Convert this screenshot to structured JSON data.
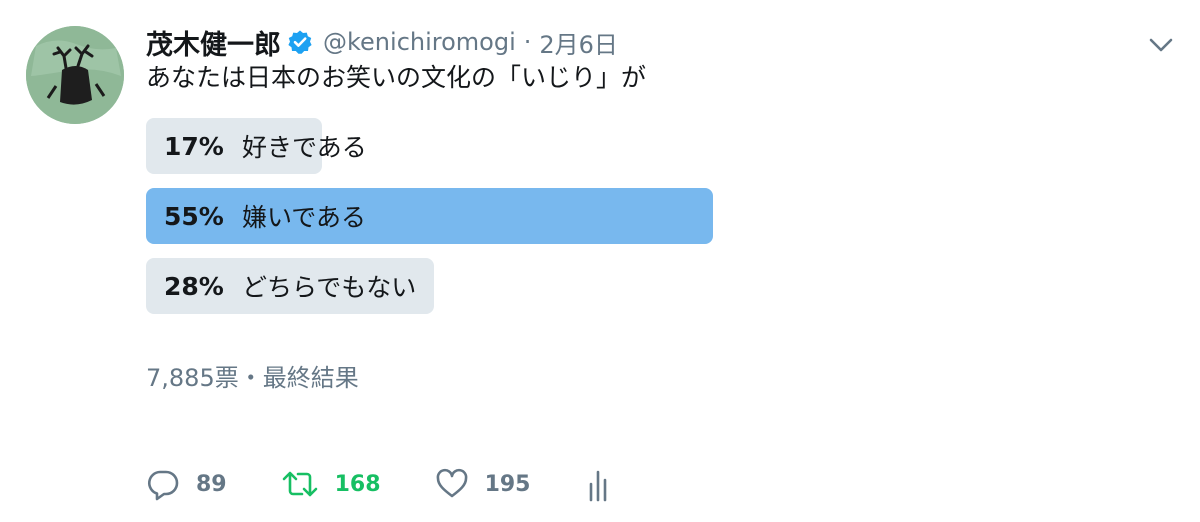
{
  "tweet": {
    "author": {
      "display_name": "茂木健一郎",
      "handle": "@kenichiromogi",
      "verified": true
    },
    "separator": "·",
    "date": "2月6日",
    "text": "あなたは日本のお笑いの文化の「いじり」が"
  },
  "poll": {
    "options": [
      {
        "percent": "17%",
        "label": "好きである",
        "share": 0.17,
        "winner": false
      },
      {
        "percent": "55%",
        "label": "嫌いである",
        "share": 0.55,
        "winner": true
      },
      {
        "percent": "28%",
        "label": "どちらでもない",
        "share": 0.28,
        "winner": false
      }
    ],
    "meta": "7,885票・最終結果"
  },
  "actions": {
    "reply_count": "89",
    "retweet_count": "168",
    "like_count": "195"
  },
  "colors": {
    "winner_bar": "#78b8ee",
    "bar": "#e1e8ed",
    "retweet": "#17bf63",
    "muted": "#657786",
    "verified": "#1da1f2"
  },
  "icons": [
    "chevron-down-icon",
    "verified-badge-icon",
    "reply-icon",
    "retweet-icon",
    "heart-icon",
    "analytics-icon"
  ]
}
